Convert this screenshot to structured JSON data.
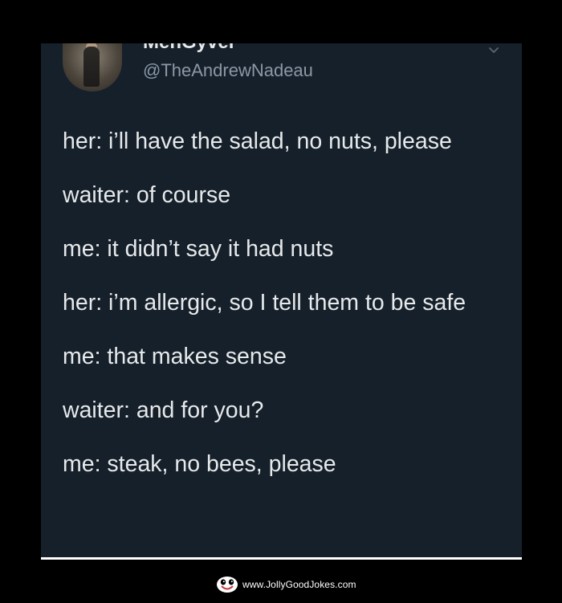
{
  "tweet": {
    "author": {
      "display_name": "MenGyver",
      "handle": "@TheAndrewNadeau"
    },
    "lines": [
      "her: i’ll have the salad, no nuts, please",
      "waiter: of course",
      "me: it didn’t say it had nuts",
      "her: i’m allergic, so I tell them to be safe",
      "me: that makes sense",
      "waiter: and for you?",
      "me: steak, no bees, please"
    ]
  },
  "watermark": {
    "site": "www.JollyGoodJokes.com",
    "logo_icon": "grinning-face-logo-icon"
  },
  "colors": {
    "page_background": "#000000",
    "card_background": "#15202b",
    "primary_text": "#e7e9ea",
    "secondary_text": "#8b98a5",
    "watermark_text": "#ffffff"
  }
}
